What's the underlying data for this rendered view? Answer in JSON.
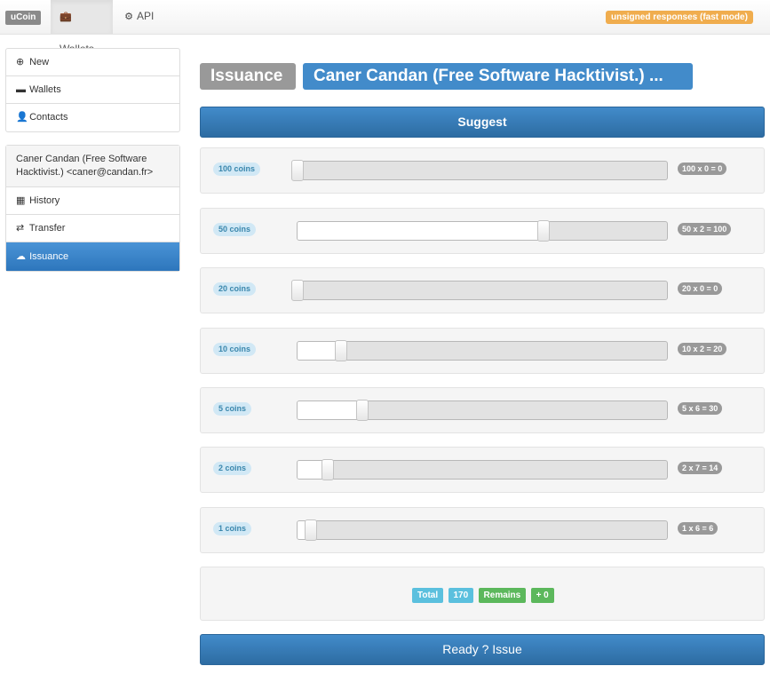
{
  "navbar": {
    "brand": "uCoin",
    "items": [
      {
        "label": "Wallets",
        "icon": "briefcase-icon",
        "active": true
      },
      {
        "label": "API",
        "icon": "gear-icon",
        "active": false
      }
    ],
    "mode_badge": "unsigned responses (fast mode)"
  },
  "sidebar": {
    "menu": [
      {
        "label": "New",
        "icon": "plus-circle-icon"
      },
      {
        "label": "Wallets",
        "icon": "credit-card-icon"
      },
      {
        "label": "Contacts",
        "icon": "user-icon"
      }
    ],
    "account_header": "Caner Candan (Free Software Hacktivist.) <caner@candan.fr>",
    "account_menu": [
      {
        "label": "History",
        "icon": "calendar-icon",
        "active": false
      },
      {
        "label": "Transfer",
        "icon": "transfer-icon",
        "active": false
      },
      {
        "label": "Issuance",
        "icon": "cloud-upload-icon",
        "active": true
      }
    ]
  },
  "page": {
    "title_label": "Issuance",
    "title_account": "Caner Candan (Free Software Hacktivist.) ...",
    "suggest_button": "Suggest",
    "issue_button": "Ready ? Issue"
  },
  "coins": [
    {
      "label": "100 coins",
      "value": 0,
      "max": 0,
      "calc": "100 x 0 = 0"
    },
    {
      "label": "50 coins",
      "value": 2,
      "max": 3,
      "calc": "50 x 2 = 100"
    },
    {
      "label": "20 coins",
      "value": 0,
      "max": 8,
      "calc": "20 x 0 = 0"
    },
    {
      "label": "10 coins",
      "value": 2,
      "max": 17,
      "calc": "10 x 2 = 20"
    },
    {
      "label": "5 coins",
      "value": 6,
      "max": 34,
      "calc": "5 x 6 = 30"
    },
    {
      "label": "2 coins",
      "value": 7,
      "max": 85,
      "calc": "2 x 7 = 14"
    },
    {
      "label": "1 coins",
      "value": 6,
      "max": 170,
      "calc": "1 x 6 = 6"
    }
  ],
  "summary": {
    "total_label": "Total",
    "total_value": "170",
    "remains_label": "Remains",
    "remains_value": "+ 0"
  },
  "colors": {
    "primary": "#428bca",
    "warning": "#f0ad4e",
    "info": "#5bc0de",
    "success": "#5cb85c",
    "default": "#999999"
  }
}
